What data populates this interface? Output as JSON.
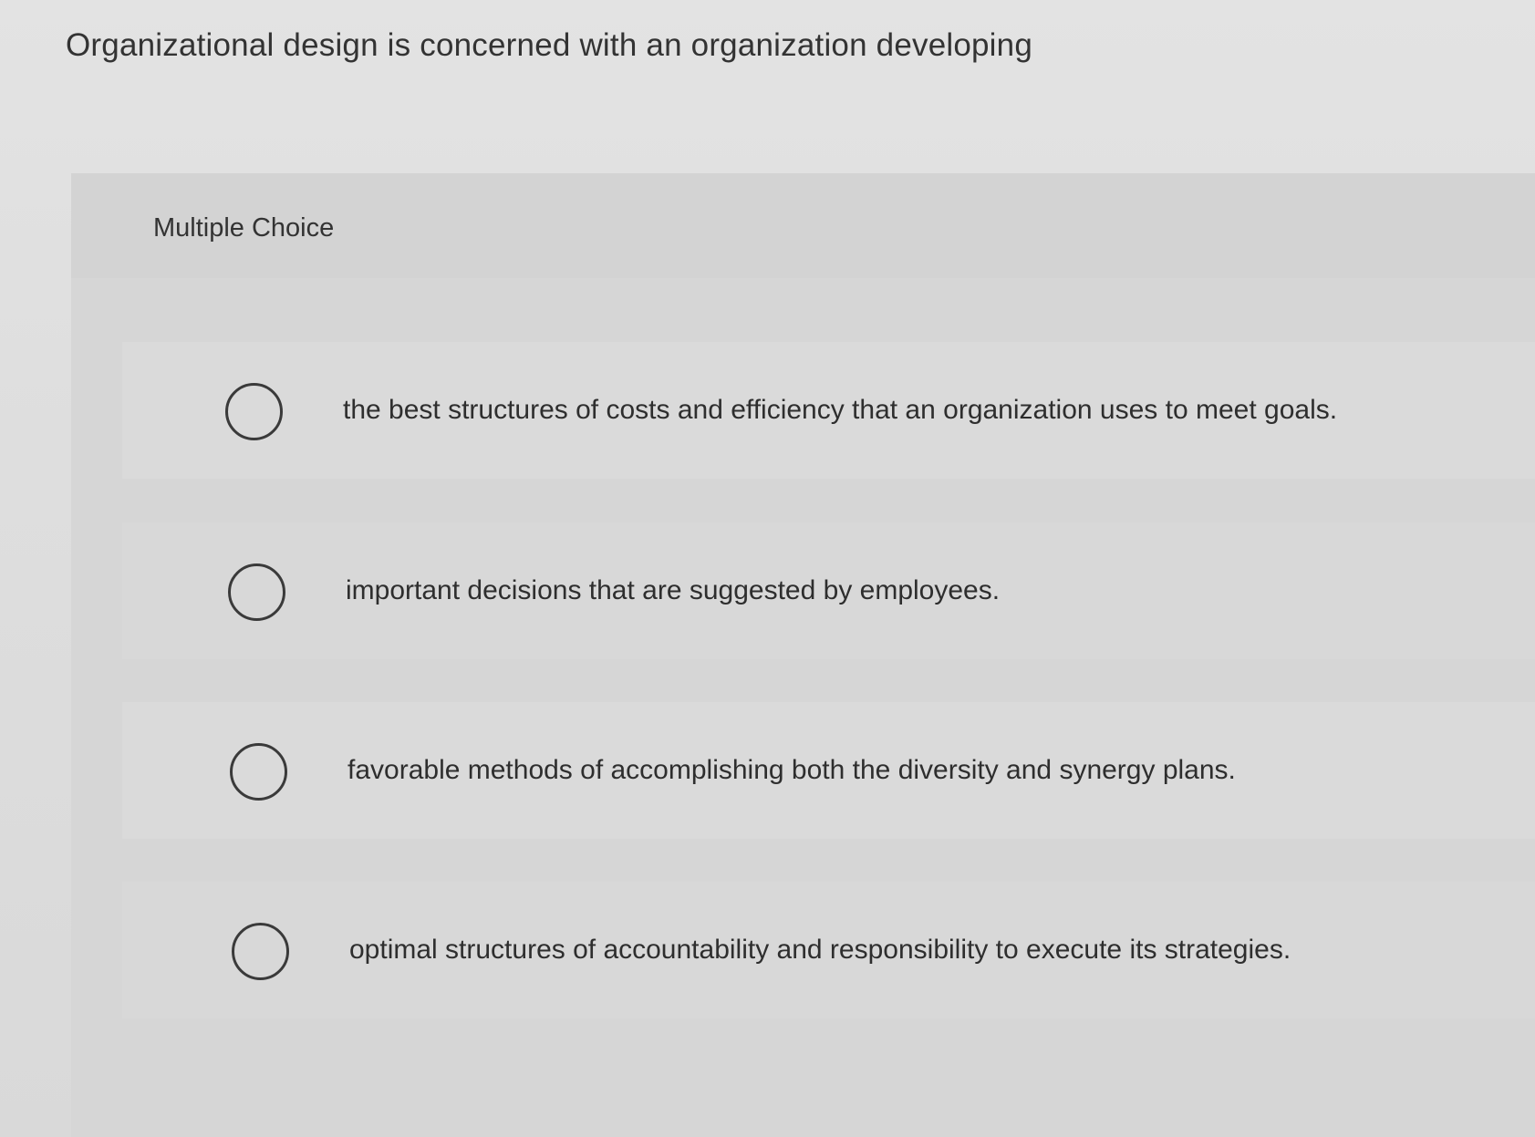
{
  "question": {
    "text": "Organizational design is concerned with an organization developing"
  },
  "panel": {
    "title": "Multiple Choice",
    "options": [
      {
        "label": "the best structures of costs and efficiency that an organization uses to meet goals.",
        "selected": false
      },
      {
        "label": "important decisions that are suggested by employees.",
        "selected": false
      },
      {
        "label": "favorable methods of accomplishing both the diversity and synergy plans.",
        "selected": false
      },
      {
        "label": "optimal structures of accountability and responsibility to execute its strategies.",
        "selected": false
      }
    ]
  }
}
